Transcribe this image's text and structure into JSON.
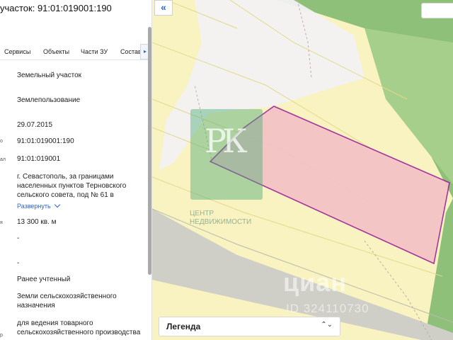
{
  "panel": {
    "title": "участок: 91:01:019001:190",
    "tabs": [
      "Сервисы",
      "Объекты",
      "Части ЗУ",
      "Состав"
    ],
    "more_arrow": "▸",
    "rows": {
      "type": "Земельный участок",
      "kind": "Землепользование",
      "date": "29.07.2015",
      "cad_number": "91:01:019001:190",
      "quarter_label": "ал",
      "quarter": "91:01:019001",
      "address_line1": "г. Севастополь, за границами",
      "address_line2": "населенных пунктов Терновского",
      "address_line3": "сельского совета, под № 61 в",
      "expand": "Развернуть",
      "area_label": "я",
      "area": "13 300 кв. м",
      "dash1": "-",
      "dash2": "-",
      "status": "Ранее учтенный",
      "category_line1": "Земли сельскохозяйственного",
      "category_line2": "назначения",
      "use_line1": "для ведения товарного",
      "use_line2": "сельскохозяйственного производства",
      "small_label": "р"
    }
  },
  "map": {
    "collapse_icon": "«",
    "legend_label": "Легенда",
    "legend_arrow": "⌃⌄",
    "watermark_letters": "РК",
    "watermark_line1": "ЦЕНТР",
    "watermark_line2": "НЕДВИЖИМОСТИ",
    "cian_watermark": "циан",
    "cian_id": "ID 324110730"
  },
  "colors": {
    "accent": "#2a62d8",
    "parcel_fill": "#f3c2c6",
    "parcel_stroke": "#9b1f9b",
    "field_yellow": "#f8f3c0",
    "forest_green": "#8fc07a",
    "road_gray": "#cfcfc7"
  }
}
